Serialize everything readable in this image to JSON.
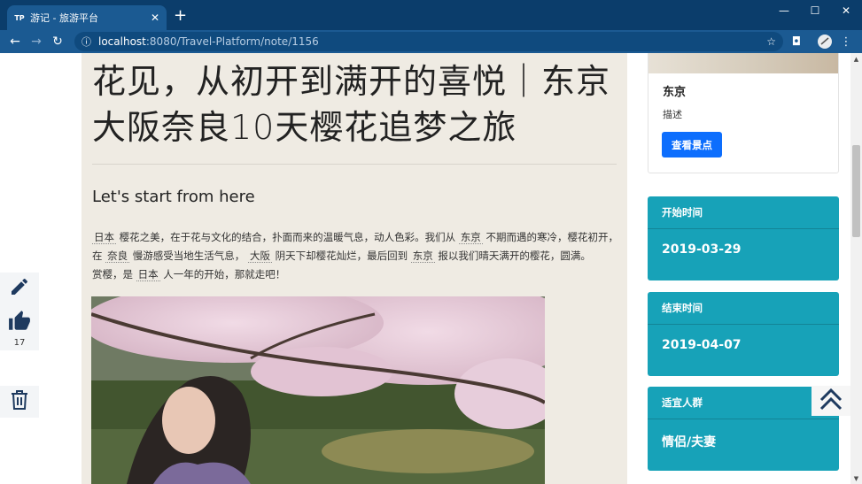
{
  "browser": {
    "tab_title": "游记 - 旅游平台",
    "favicon_text": "TP",
    "url_host": "localhost",
    "url_rest": ":8080/Travel-Platform/note/1156"
  },
  "article": {
    "title": "花见，从初开到满开的喜悦｜东京大阪奈良10天樱花追梦之旅",
    "subheading": "Let's start from here",
    "paragraph": [
      {
        "t": "日本",
        "tag": true
      },
      {
        "t": " 樱花之美，在于花与文化的结合，扑面而来的温暖气息，动人色彩。我们从 "
      },
      {
        "t": "东京",
        "tag": true
      },
      {
        "t": " 不期而遇的寒冷，樱花初开，在 "
      },
      {
        "t": "奈良",
        "tag": true
      },
      {
        "t": " 慢游感受当地生活气息， "
      },
      {
        "t": "大阪",
        "tag": true
      },
      {
        "t": " 阴天下却樱花灿烂，最后回到 "
      },
      {
        "t": "东京",
        "tag": true
      },
      {
        "t": " 报以我们晴天满开的樱花，圆满。"
      },
      {
        "t": "\n赏樱，是 "
      },
      {
        "t": "日本",
        "tag": true
      },
      {
        "t": " 人一年的开始，那就走吧！"
      }
    ]
  },
  "spot_card": {
    "name": "东京",
    "desc": "描述",
    "button": "查看景点"
  },
  "info_cards": [
    {
      "header": "开始时间",
      "value": "2019-03-29"
    },
    {
      "header": "结束时间",
      "value": "2019-04-07"
    },
    {
      "header": "适宜人群",
      "value": "情侣/夫妻"
    }
  ],
  "tools": {
    "like_count": "17"
  },
  "icons": {
    "edit": "pencil-icon",
    "like": "thumbs-up-icon",
    "delete": "trash-icon",
    "back_to_top": "double-chevron-up-icon"
  },
  "colors": {
    "info_bg": "#17a2b8",
    "primary_button": "#0d6efd",
    "article_bg": "#efebe3",
    "browser_frame": "#0b3d6b"
  }
}
